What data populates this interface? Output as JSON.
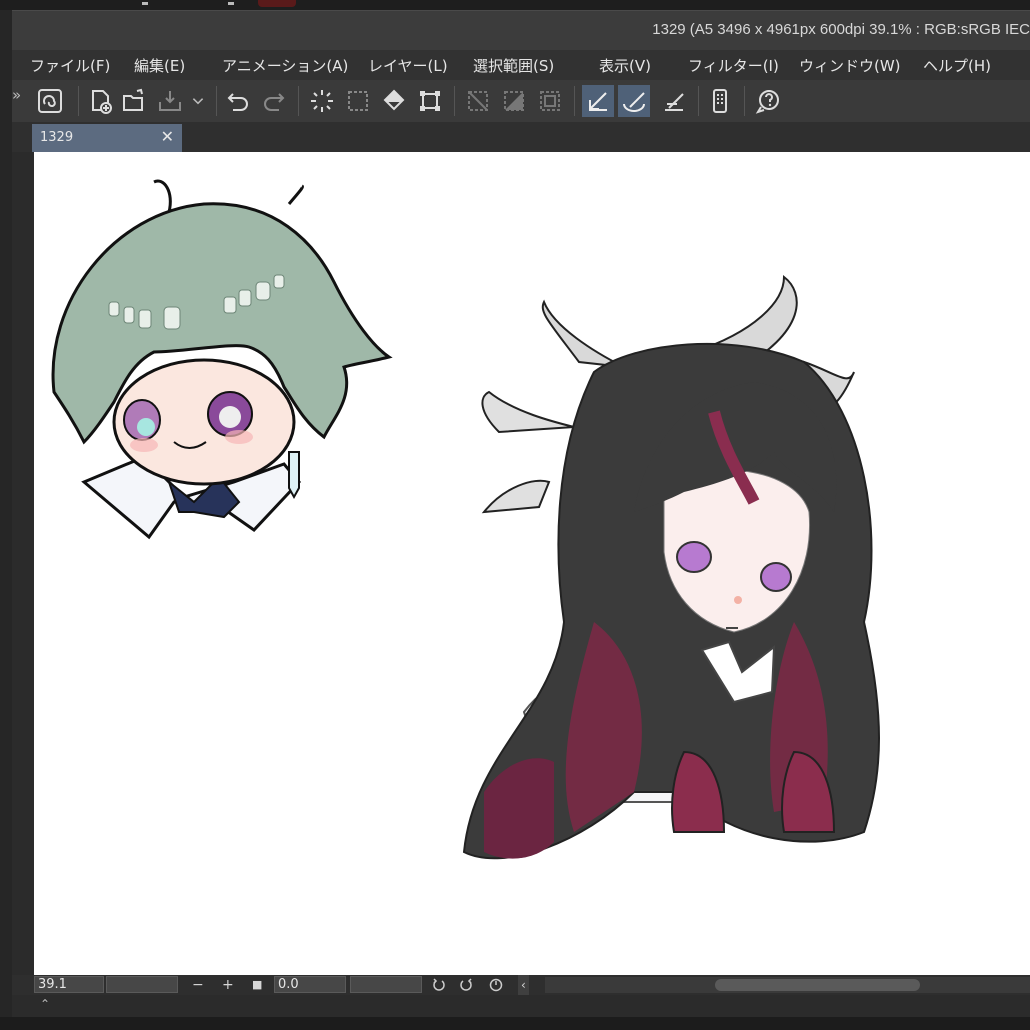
{
  "window": {
    "title": "1329 (A5 3496 x 4961px 600dpi 39.1% : RGB:sRGB IEC"
  },
  "menu": [
    "ファイル(F)",
    "編集(E)",
    "アニメーション(A)",
    "レイヤー(L)",
    "選択範囲(S)",
    "表示(V)",
    "フィルター(I)",
    "ウィンドウ(W)",
    "ヘルプ(H)"
  ],
  "toolbar": {
    "expand_glyph": "»",
    "icons": [
      "clip-studio-icon",
      "new-file-icon",
      "open-folder-icon",
      "import-icon",
      "chevron-down-icon",
      "undo-icon",
      "redo-icon",
      "busy-spinner-icon",
      "select-all-icon",
      "fill-icon",
      "transform-icon",
      "deselect-icon",
      "invert-selection-icon",
      "selection-border-icon",
      "snap-ruler-icon",
      "snap-special-ruler-icon",
      "snap-grid-icon",
      "smartphone-icon",
      "help-icon"
    ],
    "selected": [
      "snap-ruler-icon",
      "snap-special-ruler-icon"
    ]
  },
  "tab": {
    "label": "1329",
    "close_glyph": "✕"
  },
  "status": {
    "zoom": "39.1",
    "minus": "−",
    "plus": "+",
    "fit": "■",
    "rotation": "0.0",
    "left_arrow": "‹"
  },
  "bottom": {
    "expand_glyph": "⌃"
  },
  "colors": {
    "accent": "#5c6b80",
    "selected_tool": "#4f6178",
    "canvas": "#ffffff"
  }
}
